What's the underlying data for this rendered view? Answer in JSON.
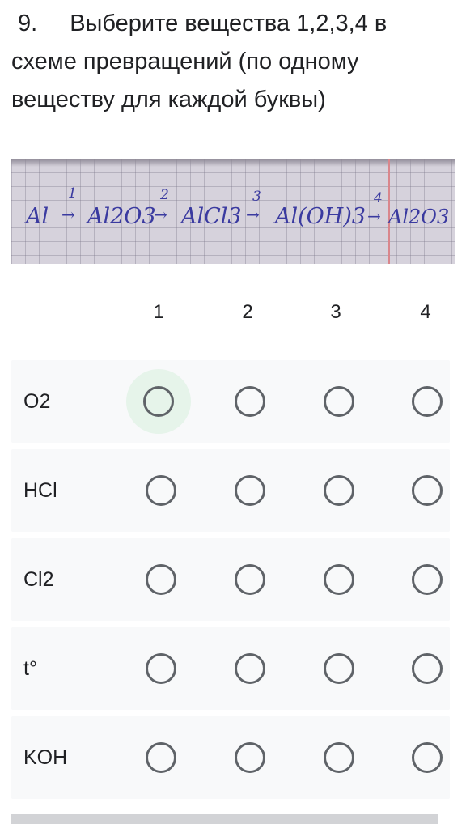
{
  "question": {
    "number": "9.",
    "text": "Выберите вещества 1,2,3,4 в схеме превращений (по одному веществу для каждой буквы)"
  },
  "scheme": {
    "compounds": [
      "Al",
      "Al2O3",
      "AlCl3",
      "Al(OH)3",
      "Al2O3"
    ],
    "step_numbers": [
      "1",
      "2",
      "3",
      "4"
    ]
  },
  "grid": {
    "columns": [
      "1",
      "2",
      "3",
      "4"
    ],
    "rows": [
      {
        "label": "O2",
        "selected": null
      },
      {
        "label": "HCl",
        "selected": null
      },
      {
        "label": "Cl2",
        "selected": null
      },
      {
        "label": "t°",
        "selected": null
      },
      {
        "label": "KOH",
        "selected": null
      }
    ]
  },
  "colors": {
    "hover_highlight": "#e6f4ea",
    "radio_border": "#5f6368",
    "row_background": "#f8f9fa"
  }
}
